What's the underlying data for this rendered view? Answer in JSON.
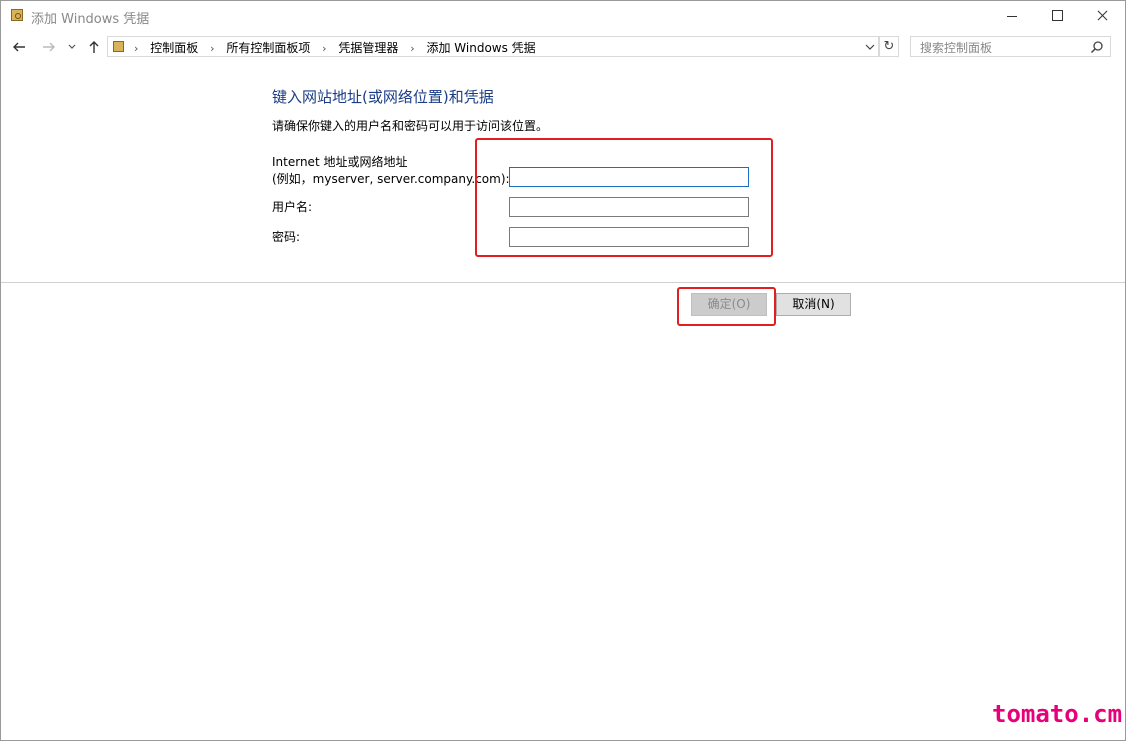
{
  "window": {
    "title": "添加 Windows 凭据"
  },
  "nav": {
    "back_icon": "arrow-left-icon",
    "forward_icon": "arrow-right-icon",
    "up_icon": "arrow-up-icon",
    "breadcrumbs": [
      "控制面板",
      "所有控制面板项",
      "凭据管理器",
      "添加 Windows 凭据"
    ],
    "search_placeholder": "搜索控制面板"
  },
  "form": {
    "heading": "键入网站地址(或网络位置)和凭据",
    "subtext": "请确保你键入的用户名和密码可以用于访问该位置。",
    "address_label_line1": "Internet 地址或网络地址",
    "address_label_line2": "(例如，myserver, server.company.com):",
    "address_value": "",
    "username_label": "用户名:",
    "username_value": "",
    "password_label": "密码:",
    "password_value": ""
  },
  "buttons": {
    "ok_label": "确定(O)",
    "cancel_label": "取消(N)"
  },
  "colors": {
    "heading": "#1b3d87",
    "highlight": "#e02020",
    "watermark": "#e8007a"
  },
  "watermark": "tomato.cm"
}
